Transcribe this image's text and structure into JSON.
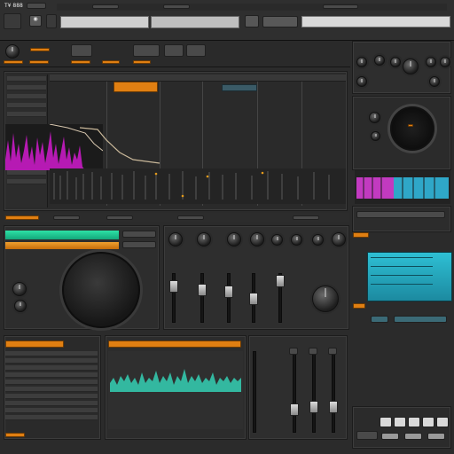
{
  "app": {
    "title": "T¥ 888",
    "tab_labels": [
      "",
      "",
      ""
    ]
  },
  "arrange": {
    "clip_label": "",
    "track_labels": [
      "",
      "",
      "",
      ""
    ]
  },
  "mixer": {
    "channels": [
      "",
      "",
      "",
      ""
    ]
  },
  "colors": {
    "accent_orange": "#e88a14",
    "accent_teal": "#2fb8c6",
    "accent_green": "#1fd39a",
    "accent_magenta": "#d41ad1",
    "panel_dark": "#2b2b2b"
  },
  "icons": [
    "play-icon",
    "record-icon",
    "gear-icon",
    "power-icon"
  ]
}
